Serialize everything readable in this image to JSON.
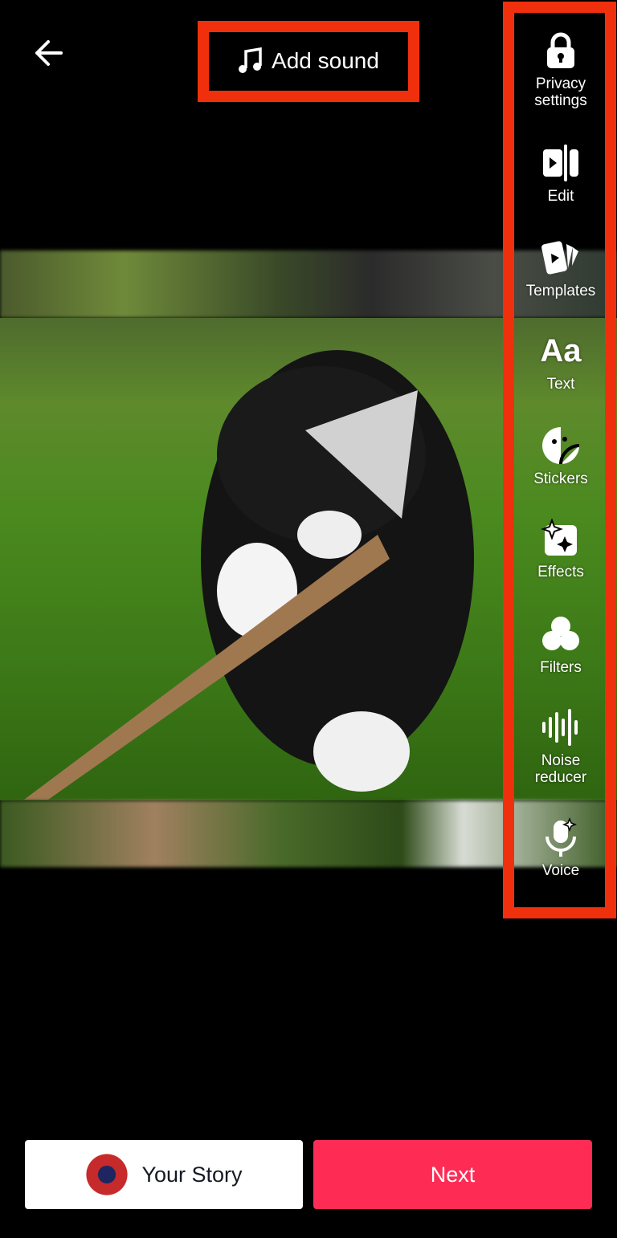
{
  "header": {
    "back_icon": "arrow-left-icon",
    "add_sound_label": "Add sound",
    "add_sound_icon": "music-note-icon"
  },
  "sidebar": {
    "items": [
      {
        "label": "Privacy settings",
        "icon": "lock-icon"
      },
      {
        "label": "Edit",
        "icon": "edit-clip-icon"
      },
      {
        "label": "Templates",
        "icon": "templates-icon"
      },
      {
        "label": "Text",
        "icon": "text-icon",
        "glyph": "Aa"
      },
      {
        "label": "Stickers",
        "icon": "sticker-icon"
      },
      {
        "label": "Effects",
        "icon": "effects-icon"
      },
      {
        "label": "Filters",
        "icon": "filters-icon"
      },
      {
        "label": "Noise reducer",
        "icon": "waveform-icon"
      },
      {
        "label": "Voice",
        "icon": "voice-icon"
      }
    ]
  },
  "footer": {
    "story_label": "Your Story",
    "next_label": "Next"
  },
  "colors": {
    "highlight": "#f0300c",
    "next": "#fe2c55"
  }
}
